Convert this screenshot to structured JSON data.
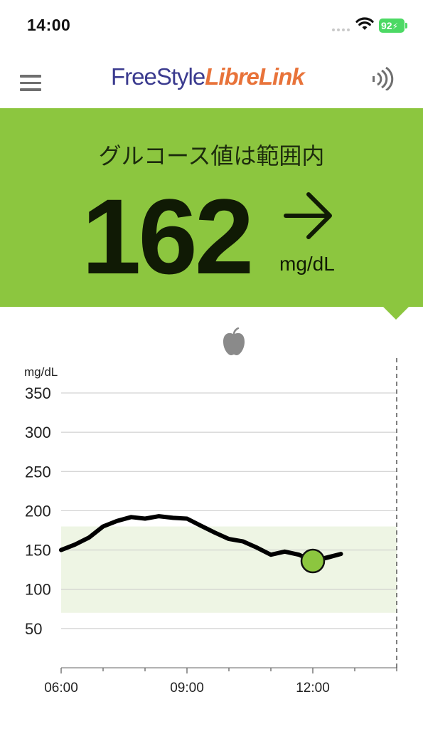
{
  "status_bar": {
    "time": "14:00",
    "battery": "92"
  },
  "header": {
    "logo_freestyle": "FreeStyle",
    "logo_librelink": "LibreLink",
    "menu_icon": "hamburger-menu-icon",
    "scan_icon": "nfc-scan-icon"
  },
  "reading": {
    "status_message": "グルコース値は範囲内",
    "value": "162",
    "unit": "mg/dL",
    "trend": "steady-right-arrow",
    "panel_color": "#8cc63f"
  },
  "chart_data": {
    "type": "line",
    "ylabel": "mg/dL",
    "ylim": [
      0,
      350
    ],
    "y_ticks": [
      350,
      300,
      250,
      200,
      150,
      100,
      50
    ],
    "x_ticks": [
      "06:00",
      "09:00",
      "12:00"
    ],
    "x_range_hours": [
      6,
      14
    ],
    "target_range": [
      70,
      180
    ],
    "target_color": "#eef5e4",
    "line_color": "#000000",
    "marker_color": "#8cc63f",
    "event_marker": "apple-icon",
    "series": [
      {
        "points": [
          [
            6.0,
            150
          ],
          [
            6.33,
            157
          ],
          [
            6.67,
            166
          ],
          [
            7.0,
            180
          ],
          [
            7.33,
            187
          ],
          [
            7.67,
            192
          ],
          [
            8.0,
            190
          ],
          [
            8.33,
            193
          ],
          [
            8.67,
            191
          ],
          [
            9.0,
            190
          ],
          [
            9.33,
            181
          ],
          [
            9.67,
            172
          ],
          [
            10.0,
            164
          ],
          [
            10.33,
            161
          ],
          [
            10.67,
            153
          ],
          [
            11.0,
            144
          ],
          [
            11.33,
            148
          ],
          [
            11.67,
            144
          ],
          [
            12.0,
            136
          ],
          [
            12.33,
            140
          ],
          [
            12.67,
            145
          ],
          [
            12.0,
            136
          ]
        ]
      }
    ]
  }
}
